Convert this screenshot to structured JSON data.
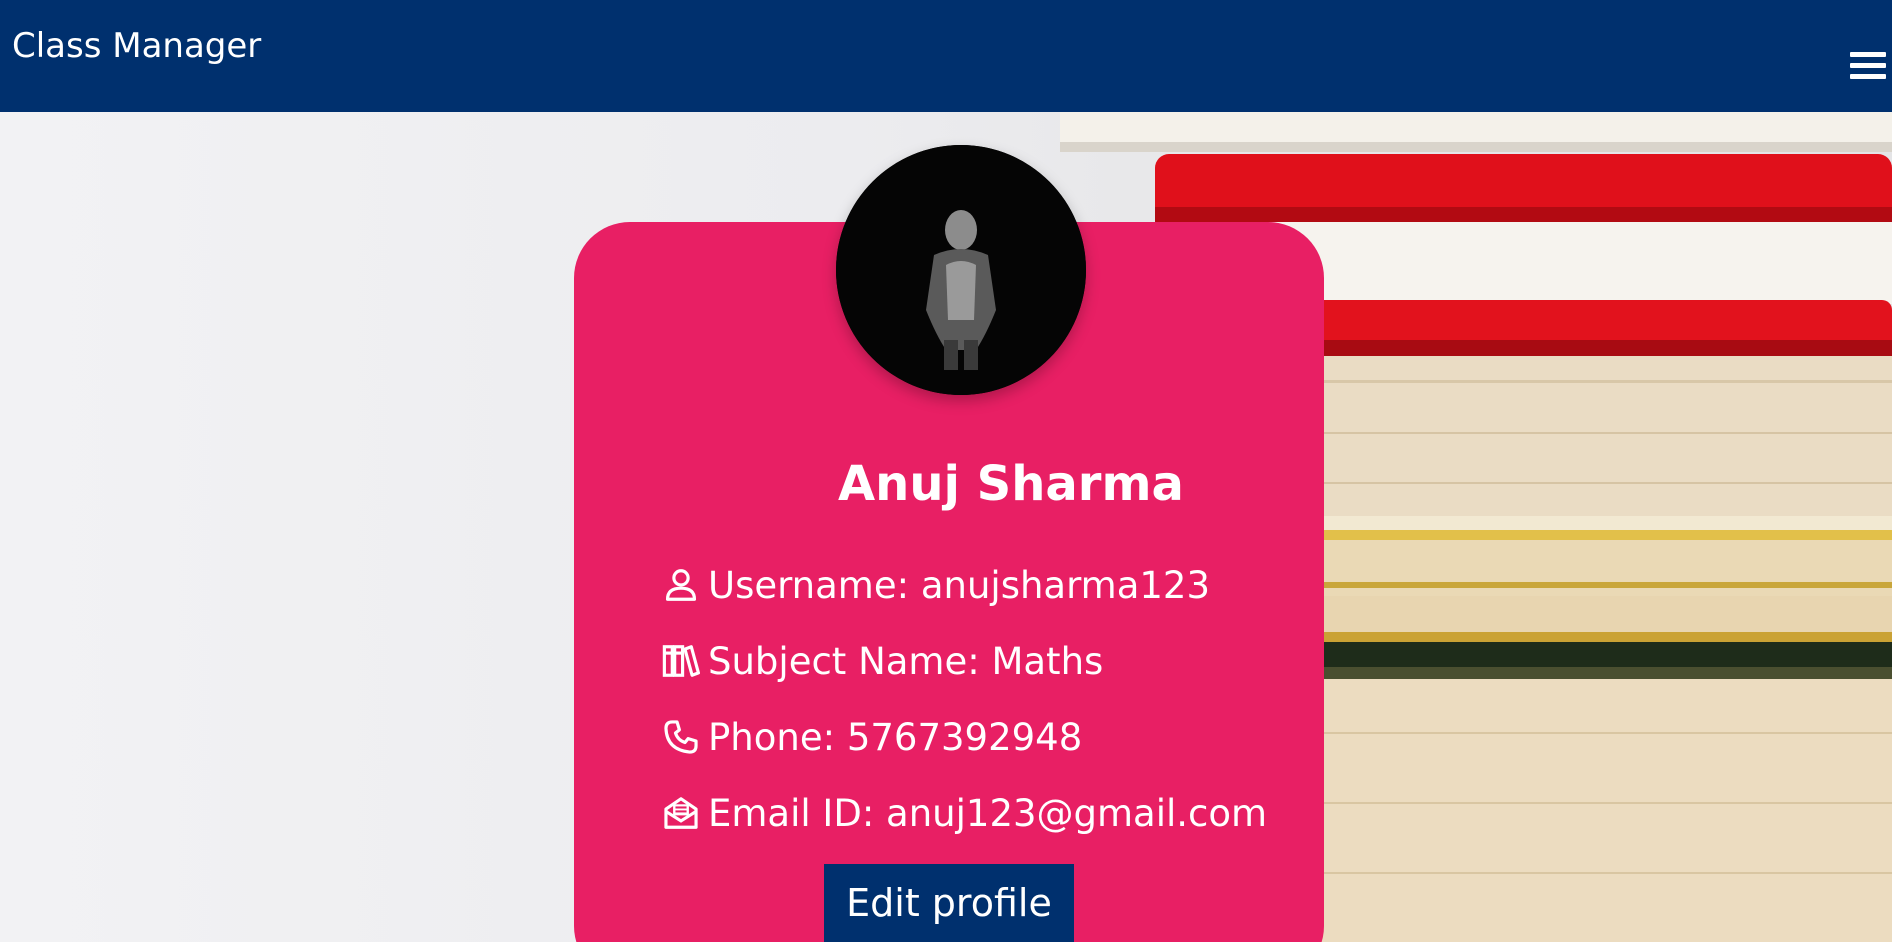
{
  "app": {
    "title": "Class Manager"
  },
  "nav": {
    "menu_icon": "hamburger-menu-icon"
  },
  "profile": {
    "name": "Anuj Sharma",
    "username": "Username: anujsharma123",
    "subject": "Subject Name: Maths",
    "phone": "Phone: 5767392948",
    "email": "Email ID: anuj123@gmail.com",
    "edit_label": "Edit profile",
    "avatar_icon": "user-photo"
  },
  "icons": {
    "username": "user-icon",
    "subject": "books-icon",
    "phone": "phone-icon",
    "email": "envelope-open-icon"
  },
  "colors": {
    "navbar": "#00306e",
    "card": "#e81f64",
    "button": "#00306e",
    "text": "#ffffff"
  }
}
